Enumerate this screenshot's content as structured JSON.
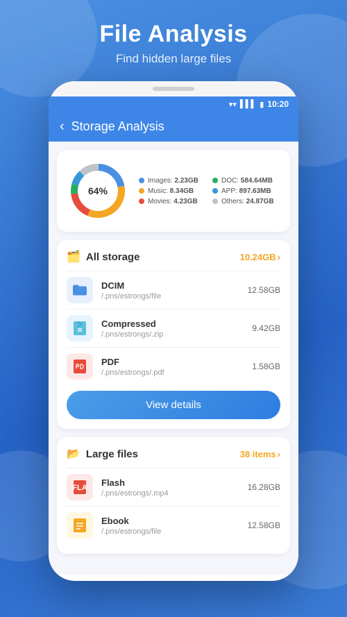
{
  "page": {
    "title": "File Analysis",
    "subtitle": "Find hidden large files",
    "bg_color": "#3a7bd5"
  },
  "phone": {
    "status_bar": {
      "time": "10:20",
      "wifi_icon": "wifi",
      "signal_icon": "signal",
      "battery_icon": "battery"
    },
    "app_header": {
      "back_label": "‹",
      "title": "Storage Analysis"
    }
  },
  "chart": {
    "center_label": "64%",
    "segments": [
      {
        "label": "Images",
        "value": "2.23GB",
        "color": "#4a90e2",
        "percent": 22
      },
      {
        "label": "Music",
        "value": "8.34GB",
        "color": "#f5a623",
        "percent": 34
      },
      {
        "label": "Movies",
        "value": "4.23GB",
        "color": "#e74c3c",
        "percent": 17
      },
      {
        "label": "DOC",
        "value": "584.64MB",
        "color": "#27ae60",
        "percent": 6
      },
      {
        "label": "APP",
        "value": "897.63MB",
        "color": "#3498db",
        "percent": 9
      },
      {
        "label": "Others",
        "value": "24.87GB",
        "color": "#bdc3c7",
        "percent": 12
      }
    ]
  },
  "all_storage": {
    "section_title": "All storage",
    "section_icon": "🗂️",
    "total_size": "10.24GB",
    "chevron": "›",
    "files": [
      {
        "name": "DCIM",
        "path": "/.pns/estrongs/file",
        "size": "12.58GB",
        "icon_type": "blue",
        "icon_char": "📁"
      },
      {
        "name": "Compressed",
        "path": "/.pns/estrongs/.zip",
        "size": "9.42GB",
        "icon_type": "zip",
        "icon_char": "🗜"
      },
      {
        "name": "PDF",
        "path": "/.pns/estrongs/.pdf",
        "size": "1.58GB",
        "icon_type": "pdf",
        "icon_char": "📄"
      }
    ],
    "view_details_label": "View details"
  },
  "large_files": {
    "section_title": "Large files",
    "section_icon": "📂",
    "badge": "38 items",
    "chevron": "›",
    "files": [
      {
        "name": "Flash",
        "path": "/.pns/estrongs/.mp4",
        "size": "16.28GB",
        "icon_type": "flash",
        "icon_char": "⚡"
      },
      {
        "name": "Ebook",
        "path": "/.pns/estrongs/file",
        "size": "12.58GB",
        "icon_type": "ebook",
        "icon_char": "📒"
      }
    ]
  }
}
